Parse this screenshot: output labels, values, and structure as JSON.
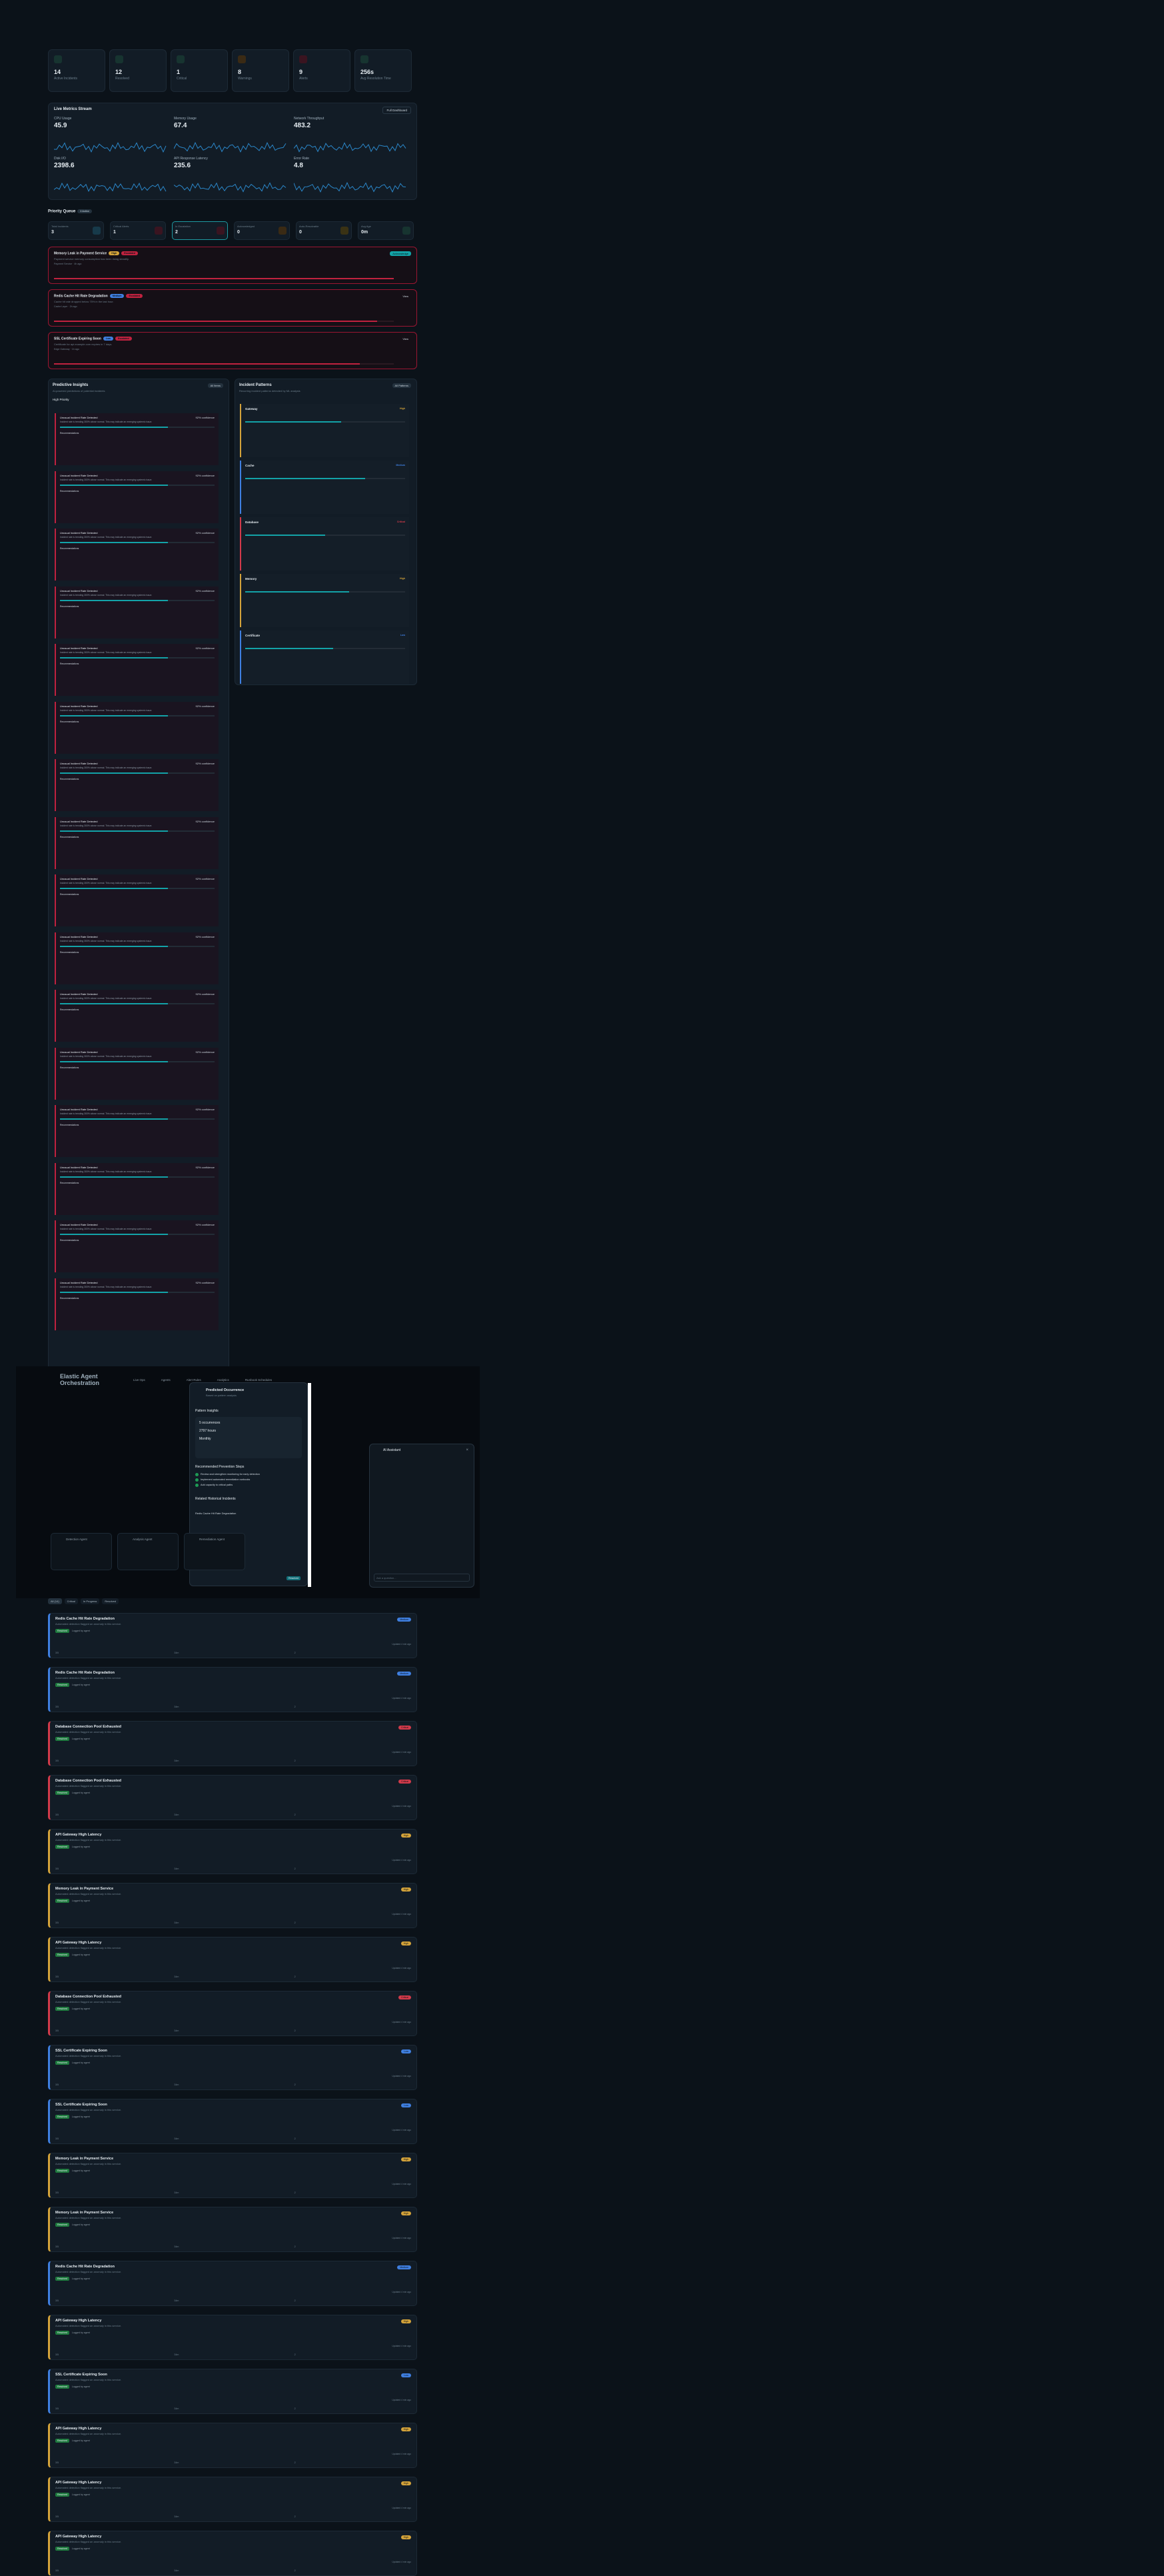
{
  "stats": [
    {
      "value": "14",
      "label": "Active Incidents"
    },
    {
      "value": "12",
      "label": "Resolved"
    },
    {
      "value": "1",
      "label": "Critical"
    },
    {
      "value": "8",
      "label": "Warnings"
    },
    {
      "value": "9",
      "label": "Alerts"
    },
    {
      "value": "256s",
      "label": "Avg Resolution Time"
    }
  ],
  "live_metrics": {
    "title": "Live Metrics Stream",
    "button": "Full Dashboard",
    "items": [
      {
        "label": "CPU Usage",
        "value": "45.9"
      },
      {
        "label": "Memory Usage",
        "value": "67.4"
      },
      {
        "label": "Network Throughput",
        "value": "483.2"
      },
      {
        "label": "Disk I/O",
        "value": "2398.6"
      },
      {
        "label": "API Response Latency",
        "value": "235.6"
      },
      {
        "label": "Error Rate",
        "value": "4.8"
      }
    ]
  },
  "priority_queue": {
    "title": "Priority Queue",
    "badge": "3 Active",
    "stats": [
      {
        "label": "Total Incidents",
        "value": "3"
      },
      {
        "label": "Critical Alerts",
        "value": "1"
      },
      {
        "label": "In Escalation",
        "value": "2"
      },
      {
        "label": "Acknowledged",
        "value": "0"
      },
      {
        "label": "Auto-Resolvable",
        "value": "0"
      },
      {
        "label": "Avg Age",
        "value": "0m"
      }
    ],
    "alerts": [
      {
        "title": "Memory Leak in Payment Service",
        "badges": [
          "High",
          "Escalated"
        ],
        "desc": "Payment service memory consumption has been rising steadily.",
        "meta": "Payment Service · 4h ago",
        "button": "Acknowledge"
      },
      {
        "title": "Redis Cache Hit Rate Degradation",
        "badges": [
          "Medium",
          "Escalated"
        ],
        "desc": "Cache hit rate dropped below 75% in the last hour.",
        "meta": "Cache Layer · 2h ago",
        "button": "View"
      },
      {
        "title": "SSL Certificate Expiring Soon",
        "badges": [
          "Low",
          "Escalated"
        ],
        "desc": "Certificate for api.example.com expires in 7 days.",
        "meta": "Edge Gateway · 1h ago",
        "button": "View"
      }
    ]
  },
  "predictive": {
    "title": "Predictive Insights",
    "filter": "All Items",
    "subtitle": "AI-powered predictions of potential incidents",
    "group": "High Priority",
    "item_title": "Unusual Incident Rate Detected",
    "item_conf": "92% confidence",
    "item_desc": "Incident rate is trending 300% above normal. This may indicate an emerging systemic issue.",
    "item_rec": "Recommendations",
    "count": 16
  },
  "patterns": {
    "title": "Incident Patterns",
    "filter": "All Patterns",
    "subtitle": "Recurring incident patterns detected by ML analysis",
    "items": [
      {
        "name": "Gateway",
        "level": "High",
        "fill": 0.6
      },
      {
        "name": "Cache",
        "level": "Medium",
        "fill": 0.75
      },
      {
        "name": "Database",
        "level": "Critical",
        "fill": 0.5
      },
      {
        "name": "Memory",
        "level": "High",
        "fill": 0.65
      },
      {
        "name": "Certificate",
        "level": "Low",
        "fill": 0.55
      }
    ]
  },
  "modal": {
    "title": "Predicted Occurrence",
    "subtitle": "Based on pattern analysis",
    "section1": "Pattern Insights",
    "section2": "Recommended Prevention Steps",
    "section3": "Related Historical Incidents",
    "f1": "5 occurrences",
    "f2": "2797 hours",
    "f3": "Monthly",
    "steps": [
      "Review and strengthen monitoring for early detection",
      "Implement automated remediation runbooks",
      "Add capacity to critical paths"
    ],
    "incident": "Redis Cache Hit Rate Degradation",
    "incident_badge": "Resolved"
  },
  "nav": {
    "brand": "Elastic Agent Orchestration",
    "tabs": [
      "Live Ops",
      "Agents",
      "Alert Rules",
      "Analytics",
      "Runbook Schedules"
    ]
  },
  "assistant": {
    "title": "AI Assistant",
    "placeholder": "Ask a question..."
  },
  "bottom_agents": [
    "Detection Agent",
    "Analysis Agent",
    "Remediation Agent"
  ],
  "filters": [
    "All (14)",
    "Critical",
    "In Progress",
    "Resolved"
  ],
  "incidents": [
    {
      "title": "Redis Cache Hit Rate Degradation",
      "sev": "Medium",
      "color": "#3f7fe0"
    },
    {
      "title": "Redis Cache Hit Rate Degradation",
      "sev": "Medium",
      "color": "#3f7fe0"
    },
    {
      "title": "Database Connection Pool Exhausted",
      "sev": "Critical",
      "color": "#d23a4a"
    },
    {
      "title": "Database Connection Pool Exhausted",
      "sev": "Critical",
      "color": "#d23a4a"
    },
    {
      "title": "API Gateway High Latency",
      "sev": "High",
      "color": "#d4a33a"
    },
    {
      "title": "Memory Leak in Payment Service",
      "sev": "High",
      "color": "#d4a33a"
    },
    {
      "title": "API Gateway High Latency",
      "sev": "High",
      "color": "#d4a33a"
    },
    {
      "title": "Database Connection Pool Exhausted",
      "sev": "Critical",
      "color": "#d23a4a"
    },
    {
      "title": "SSL Certificate Expiring Soon",
      "sev": "Low",
      "color": "#3f7fe0"
    },
    {
      "title": "SSL Certificate Expiring Soon",
      "sev": "Low",
      "color": "#3f7fe0"
    },
    {
      "title": "Memory Leak in Payment Service",
      "sev": "High",
      "color": "#d4a33a"
    },
    {
      "title": "Memory Leak in Payment Service",
      "sev": "High",
      "color": "#d4a33a"
    },
    {
      "title": "Redis Cache Hit Rate Degradation",
      "sev": "Medium",
      "color": "#3f7fe0"
    },
    {
      "title": "API Gateway High Latency",
      "sev": "High",
      "color": "#d4a33a"
    },
    {
      "title": "SSL Certificate Expiring Soon",
      "sev": "Low",
      "color": "#3f7fe0"
    },
    {
      "title": "API Gateway High Latency",
      "sev": "High",
      "color": "#d4a33a"
    },
    {
      "title": "API Gateway High Latency",
      "sev": "High",
      "color": "#d4a33a"
    },
    {
      "title": "API Gateway High Latency",
      "sev": "High",
      "color": "#d4a33a"
    }
  ],
  "incident_common": {
    "desc": "Automated detection flagged an anomaly in this service.",
    "tag": "Resolved",
    "agent": "Logged by agent",
    "ts": "Updated 4 min ago",
    "f1": "Affected",
    "f2": "Duration",
    "f3": "Alerts",
    "v1": "3/5",
    "v2": "34m",
    "v3": "2"
  }
}
